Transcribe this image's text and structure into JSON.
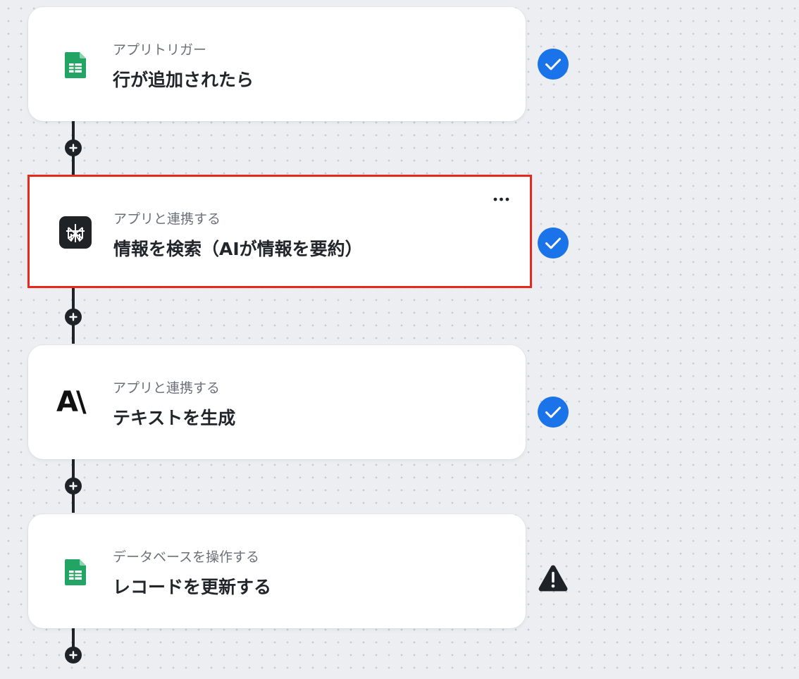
{
  "flow": {
    "steps": [
      {
        "subtitle": "アプリトリガー",
        "title": "行が追加されたら",
        "app_icon": "google-sheets-icon",
        "status": "completed"
      },
      {
        "subtitle": "アプリと連携する",
        "title": "情報を検索（AIが情報を要約）",
        "app_icon": "perplexity-icon",
        "status": "completed",
        "selected": true
      },
      {
        "subtitle": "アプリと連携する",
        "title": "テキストを生成",
        "app_icon": "anthropic-icon",
        "app_icon_text": "A\\",
        "status": "completed"
      },
      {
        "subtitle": "データベースを操作する",
        "title": "レコードを更新する",
        "app_icon": "google-sheets-icon",
        "status": "warning"
      }
    ]
  },
  "colors": {
    "selected_border": "#e8281a",
    "success": "#1a73e8",
    "warning": "#1f2328",
    "sheets_green": "#21a464",
    "canvas": "#eceef2"
  }
}
